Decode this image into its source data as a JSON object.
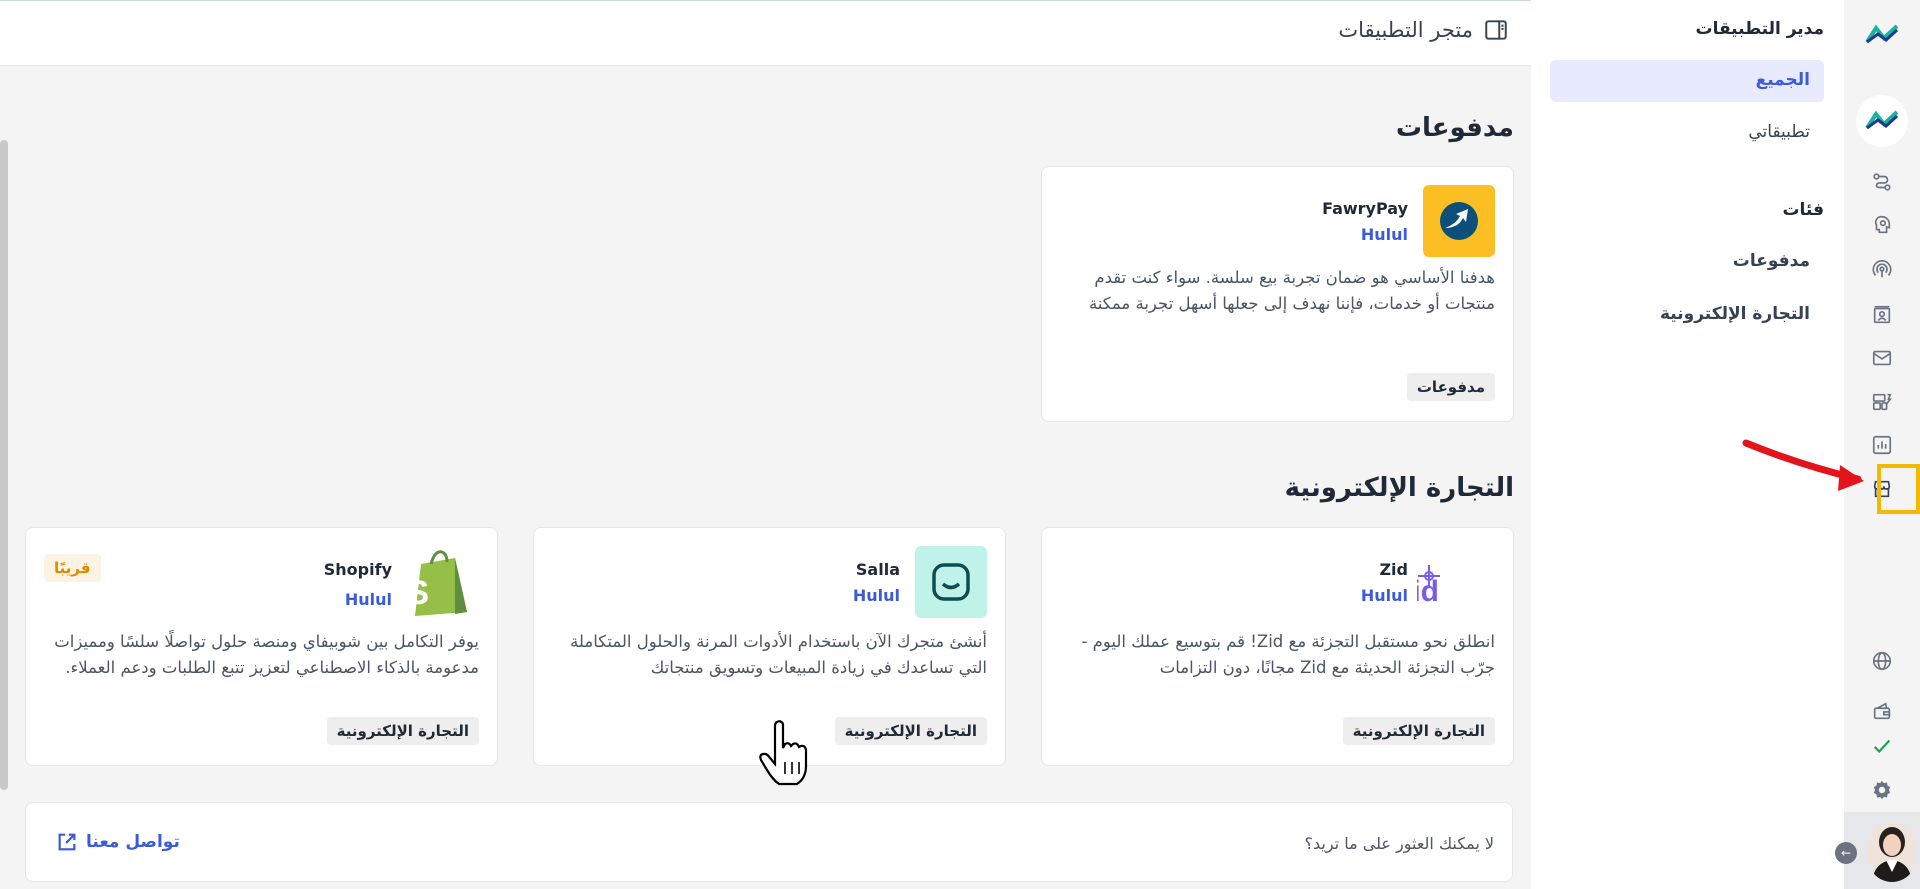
{
  "header": {
    "title": "متجر التطبيقات"
  },
  "sections": {
    "payments_title": "مدفوعات",
    "ecommerce_title": "التجارة الإلكترونية"
  },
  "cards": {
    "fawrypay": {
      "name": "FawryPay",
      "vendor": "Hulul",
      "desc": "هدفنا الأساسي هو ضمان تجربة بيع سلسة. سواء كنت تقدم منتجات أو خدمات، فإننا نهدف إلى جعلها أسهل تجربة ممكنة",
      "tag": "مدفوعات"
    },
    "zid": {
      "name": "Zid",
      "vendor": "Hulul",
      "desc": "انطلق نحو مستقبل التجزئة مع Zid! قم بتوسيع عملك اليوم - جرّب التجزئة الحديثة مع Zid مجانًا، دون التزامات",
      "tag": "التجارة الإلكترونية",
      "logo_text": "zid"
    },
    "salla": {
      "name": "Salla",
      "vendor": "Hulul",
      "desc": "أنشئ متجرك الآن باستخدام الأدوات المرنة والحلول المتكاملة التي تساعدك في زيادة المبيعات وتسويق منتجاتك",
      "tag": "التجارة الإلكترونية"
    },
    "shopify": {
      "name": "Shopify",
      "vendor": "Hulul",
      "desc": "يوفر التكامل بين شوبيفاي ومنصة حلول تواصلًا سلسًا ومميزات مدعومة بالذكاء الاصطناعي لتعزيز تتبع الطلبات ودعم العملاء.",
      "tag": "التجارة الإلكترونية",
      "badge": "قريبًا"
    }
  },
  "footer": {
    "question": "لا يمكنك العثور على ما تريد؟",
    "contact": "تواصل معنا"
  },
  "sidebar": {
    "heading": "مدير التطبيقات",
    "all": "الجميع",
    "my_apps": "تطبيقاتي",
    "categories_heading": "فئات",
    "cat_payments": "مدفوعات",
    "cat_ecommerce": "التجارة الإلكترونية"
  },
  "rail_icons": [
    "brand-logo",
    "workspace-logo",
    "flows-icon",
    "bot-icon",
    "broadcast-icon",
    "contacts-icon",
    "inbox-icon",
    "templates-icon",
    "reports-icon",
    "app-store-icon",
    "globe-icon",
    "wallet-icon",
    "status-check-icon",
    "settings-icon"
  ],
  "colors": {
    "accent": "#3b5bdb",
    "active_bg": "#e8eafd",
    "highlight": "#f5b800",
    "annotation_arrow": "#e3141b",
    "soon_badge": "#e08a00"
  }
}
